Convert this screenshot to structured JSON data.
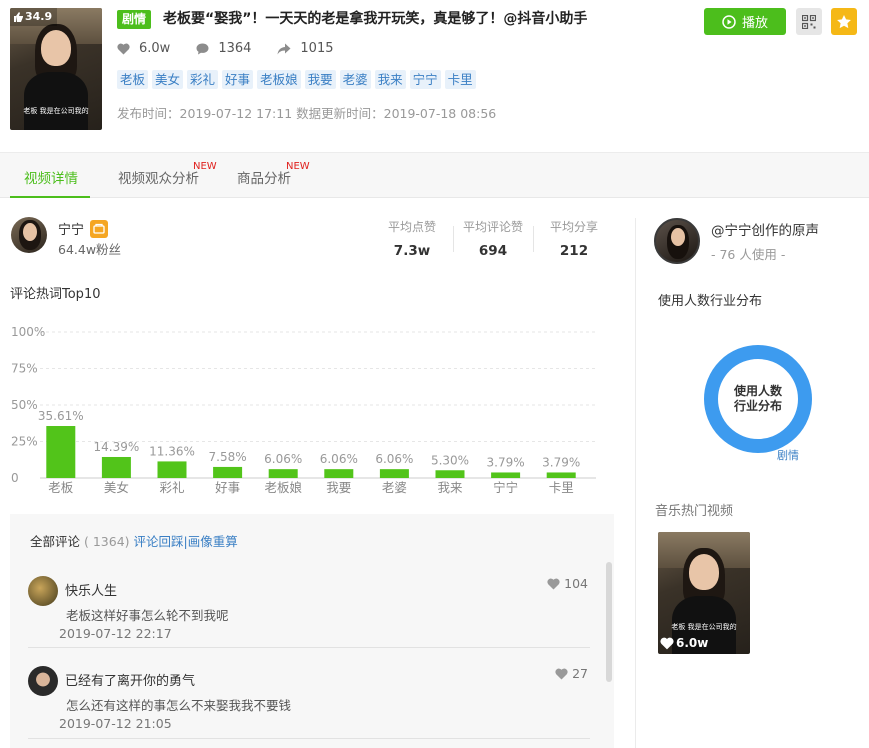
{
  "colors": {
    "accent": "#4cbe1c",
    "link": "#3a7fc4",
    "bar": "#52c41a",
    "donut": "#3d9bef",
    "new": "#e0211e"
  },
  "video": {
    "score": "34.9",
    "genre": "剧情",
    "title": "老板要“娶我”！一天天的老是拿我开玩笑，真是够了！@抖音小助手",
    "thumb_caption": "老板 我是在公司我的",
    "stats": {
      "likes": "6.0w",
      "comments": "1364",
      "shares": "1015"
    },
    "tags": [
      "老板",
      "美女",
      "彩礼",
      "好事",
      "老板娘",
      "我要",
      "老婆",
      "我来",
      "宁宁",
      "卡里"
    ],
    "times": "发布时间：2019-07-12 17:11 数据更新时间：2019-07-18 08:56"
  },
  "actions": {
    "play_label": "播放",
    "play_icon": "play-icon",
    "qr_icon": "qrcode-icon",
    "star_icon": "star-icon"
  },
  "tabs": [
    {
      "label": "视频详情",
      "new": ""
    },
    {
      "label": "视频观众分析",
      "new": "NEW"
    },
    {
      "label": "商品分析",
      "new": "NEW"
    }
  ],
  "author": {
    "name": "宁宁",
    "fans": "64.4w粉丝",
    "averages": [
      {
        "label": "平均点赞",
        "value": "7.3w"
      },
      {
        "label": "平均评论赞",
        "value": "694"
      },
      {
        "label": "平均分享",
        "value": "212"
      }
    ]
  },
  "chart_title": "评论热词Top10",
  "chart_data": {
    "type": "bar",
    "categories": [
      "老板",
      "美女",
      "彩礼",
      "好事",
      "老板娘",
      "我要",
      "老婆",
      "我来",
      "宁宁",
      "卡里"
    ],
    "values": [
      35.61,
      14.39,
      11.36,
      7.58,
      6.06,
      6.06,
      6.06,
      5.3,
      3.79,
      3.79
    ],
    "value_labels": [
      "35.61%",
      "14.39%",
      "11.36%",
      "7.58%",
      "6.06%",
      "6.06%",
      "6.06%",
      "5.30%",
      "3.79%",
      "3.79%"
    ],
    "yticks": [
      "0",
      "25%",
      "50%",
      "75%",
      "100%"
    ],
    "ylim": [
      0,
      100
    ],
    "grid": true
  },
  "comments": {
    "header_label": "全部评论",
    "count": "( 1364)",
    "link": "评论回踩|画像重算",
    "items": [
      {
        "name": "快乐人生",
        "likes": "104",
        "text": "老板这样好事怎么轮不到我呢",
        "time": "2019-07-12 22:17"
      },
      {
        "name": "已经有了离开你的勇气",
        "likes": "27",
        "text": "怎么还有这样的事怎么不来娶我我不要钱",
        "time": "2019-07-12 21:05"
      }
    ]
  },
  "music": {
    "title": "@宁宁创作的原声",
    "usage": "- 76 人使用 -",
    "distribution_title": "使用人数行业分布",
    "donut_line1": "使用人数",
    "donut_line2": "行业分布",
    "donut_tag": "剧情",
    "hot_title": "音乐热门视频",
    "hot_video_likes": "6.0w",
    "hot_video_caption": "老板 我是在公司我的"
  }
}
